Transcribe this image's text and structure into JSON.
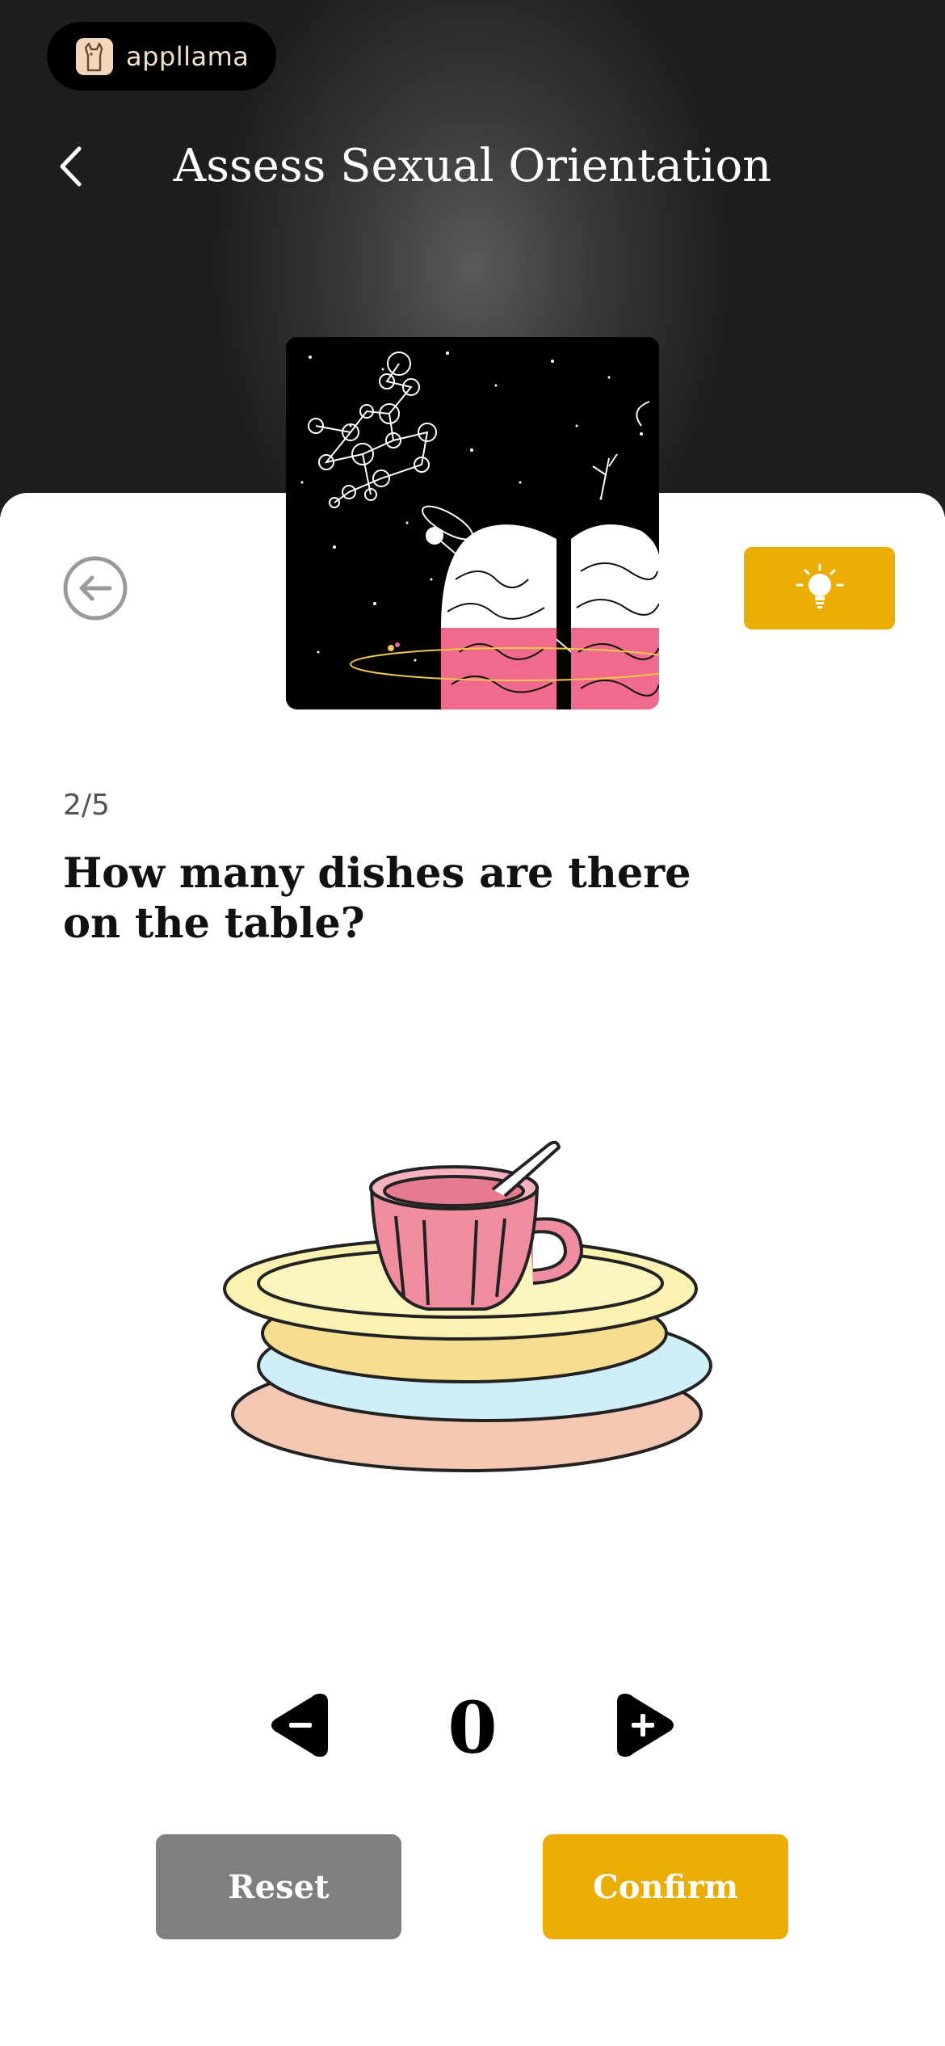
{
  "app": {
    "brand": "appllama"
  },
  "header": {
    "title": "Assess Sexual Orientation"
  },
  "quiz": {
    "progress": "2/5",
    "question": "How many dishes are there on the table?",
    "count": "0"
  },
  "actions": {
    "reset_label": "Reset",
    "confirm_label": "Confirm"
  },
  "colors": {
    "accent": "#e9ad03",
    "reset": "#7f7f7f",
    "hero_dark": "#1e1e1e",
    "brain_pink": "#ef6a8d"
  },
  "icons": [
    "llama-logo-icon",
    "chevron-left-icon",
    "circle-arrow-left-icon",
    "lightbulb-icon",
    "minus-triangle-icon",
    "plus-triangle-icon"
  ]
}
